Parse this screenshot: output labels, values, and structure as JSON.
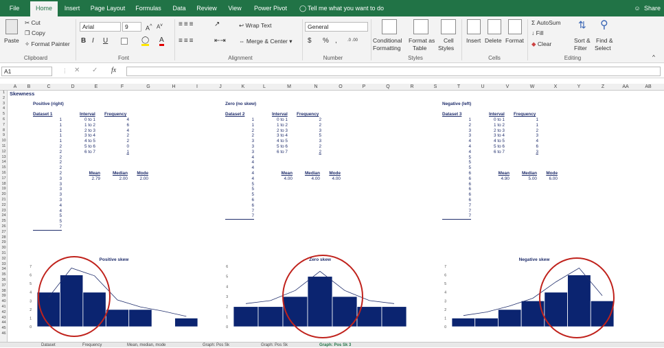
{
  "menu": {
    "tabs": [
      "File",
      "Home",
      "Insert",
      "Page Layout",
      "Formulas",
      "Data",
      "Review",
      "View",
      "Power Pivot"
    ],
    "active": "Home",
    "tell_me": "Tell me what you want to do",
    "share": "Share"
  },
  "ribbon": {
    "clipboard": {
      "paste": "Paste",
      "cut": "Cut",
      "copy": "Copy",
      "format_painter": "Format Painter",
      "label": "Clipboard"
    },
    "font": {
      "name": "Arial",
      "size": "9",
      "label": "Font"
    },
    "alignment": {
      "wrap": "Wrap Text",
      "merge": "Merge & Center",
      "label": "Alignment"
    },
    "number": {
      "format": "General",
      "label": "Number",
      "currency": "$",
      "percent": "%",
      "comma": ","
    },
    "styles": {
      "conditional": "Conditional",
      "formatting": "Formatting",
      "format_as": "Format as",
      "table": "Table",
      "cell": "Cell",
      "cell_styles": "Styles",
      "label": "Styles"
    },
    "cells": {
      "insert": "Insert",
      "delete": "Delete",
      "format": "Format",
      "label": "Cells"
    },
    "editing": {
      "autosum": "AutoSum",
      "fill": "Fill",
      "clear": "Clear",
      "sort": "Sort &",
      "filter": "Filter",
      "find": "Find &",
      "select": "Select",
      "label": "Editing"
    }
  },
  "formula_bar": {
    "name_box": "A1",
    "fx": "fx",
    "value": ""
  },
  "columns": [
    "A",
    "B",
    "C",
    "D",
    "E",
    "F",
    "G",
    "H",
    "I",
    "J",
    "K",
    "L",
    "M",
    "N",
    "O",
    "P",
    "Q",
    "R",
    "S",
    "T",
    "U",
    "V",
    "W",
    "X",
    "Y",
    "Z",
    "AA",
    "AB"
  ],
  "rows": [
    "1",
    "2",
    "3",
    "4",
    "5",
    "6",
    "7",
    "8",
    "9",
    "10",
    "11",
    "12",
    "13",
    "14",
    "15",
    "16",
    "17",
    "18",
    "19",
    "20",
    "21",
    "22",
    "23",
    "24",
    "25",
    "26",
    "27",
    "28",
    "29",
    "30",
    "31",
    "32",
    "33",
    "34",
    "35",
    "36",
    "37",
    "38",
    "39",
    "40",
    "41",
    "42",
    "43",
    "44",
    "45",
    "46"
  ],
  "sheet": {
    "title": "Skewness",
    "sections": [
      {
        "heading": "Positive (right)",
        "dataset_label": "Dataset 1",
        "dataset": [
          "1",
          "1",
          "1",
          "1",
          "1",
          "2",
          "2",
          "2",
          "2",
          "2",
          "2",
          "3",
          "3",
          "3",
          "3",
          "3",
          "4",
          "4",
          "5",
          "5",
          "7"
        ],
        "interval_header": "Interval",
        "frequency_header": "Frequency",
        "intervals": [
          "0 to 1",
          "1 to 2",
          "2 to 3",
          "3 to 4",
          "4 to 5",
          "5 to 6",
          "6 to 7"
        ],
        "frequencies": [
          "4",
          "6",
          "4",
          "2",
          "2",
          "0",
          "1"
        ],
        "mean_label": "Mean",
        "median_label": "Median",
        "mode_label": "Mode",
        "mean": "2.79",
        "median": "2.00",
        "mode": "2.00",
        "chart_title": "Positive skew"
      },
      {
        "heading": "Zero (no skew)",
        "dataset_label": "Dataset 2",
        "dataset": [
          "1",
          "1",
          "2",
          "2",
          "3",
          "3",
          "3",
          "4",
          "4",
          "4",
          "4",
          "4",
          "5",
          "5",
          "5",
          "6",
          "6",
          "7",
          "7"
        ],
        "interval_header": "Interval",
        "frequency_header": "Frequency",
        "intervals": [
          "0 to 1",
          "1 to 2",
          "2 to 3",
          "3 to 4",
          "4 to 5",
          "5 to 6",
          "6 to 7"
        ],
        "frequencies": [
          "2",
          "2",
          "3",
          "5",
          "3",
          "2",
          "2"
        ],
        "mean_label": "Mean",
        "median_label": "Median",
        "mode_label": "Mode",
        "mean": "4.00",
        "median": "4.00",
        "mode": "4.00",
        "chart_title": "Zero skew"
      },
      {
        "heading": "Negative (left)",
        "dataset_label": "Dataset 3",
        "dataset": [
          "1",
          "2",
          "3",
          "3",
          "4",
          "4",
          "4",
          "5",
          "5",
          "5",
          "6",
          "6",
          "6",
          "6",
          "6",
          "6",
          "7",
          "7",
          "7"
        ],
        "interval_header": "Interval",
        "frequency_header": "Frequency",
        "intervals": [
          "0 to 1",
          "1 to 2",
          "2 to 3",
          "3 to 4",
          "4 to 5",
          "5 to 6",
          "6 to 7"
        ],
        "frequencies": [
          "1",
          "1",
          "2",
          "3",
          "4",
          "6",
          "3"
        ],
        "mean_label": "Mean",
        "median_label": "Median",
        "mode_label": "Mode",
        "mean": "4.90",
        "median": "5.00",
        "mode": "6.00",
        "chart_title": "Negative skew"
      }
    ]
  },
  "chart_data": [
    {
      "type": "bar",
      "title": "Positive skew",
      "categories": [
        "0 to 1",
        "1 to 2",
        "2 to 3",
        "3 to 4",
        "4 to 5",
        "5 to 6",
        "6 to 7"
      ],
      "values": [
        4,
        6,
        4,
        2,
        2,
        0,
        1
      ],
      "ylim": [
        0,
        7
      ],
      "yticks": [
        "0",
        "1",
        "2",
        "3",
        "4",
        "5",
        "6",
        "7"
      ],
      "curve": [
        3.4,
        6.8,
        5.9,
        3.1,
        2.3,
        1.8,
        1.2
      ],
      "bar_color": "#0b2470"
    },
    {
      "type": "bar",
      "title": "Zero skew",
      "categories": [
        "0 to 1",
        "1 to 2",
        "2 to 3",
        "3 to 4",
        "4 to 5",
        "5 to 6",
        "6 to 7"
      ],
      "values": [
        2,
        2,
        3,
        5,
        3,
        2,
        2
      ],
      "ylim": [
        0,
        6
      ],
      "yticks": [
        "0",
        "1",
        "2",
        "3",
        "4",
        "5",
        "6"
      ],
      "curve": [
        2.3,
        2.6,
        3.6,
        5.5,
        3.6,
        2.6,
        2.3
      ],
      "bar_color": "#0b2470"
    },
    {
      "type": "bar",
      "title": "Negative skew",
      "categories": [
        "0 to 1",
        "1 to 2",
        "2 to 3",
        "3 to 4",
        "4 to 5",
        "5 to 6",
        "6 to 7"
      ],
      "values": [
        1,
        1,
        2,
        3,
        4,
        6,
        3
      ],
      "ylim": [
        0,
        7
      ],
      "yticks": [
        "0",
        "1",
        "2",
        "3",
        "4",
        "5",
        "6",
        "7"
      ],
      "curve": [
        1.3,
        1.7,
        2.4,
        3.3,
        5.2,
        6.8,
        3.6
      ],
      "bar_color": "#0b2470"
    }
  ],
  "sheet_tabs": [
    "Dataset",
    "Frequency",
    "Mean, median, mode",
    "Graph: Pos Sk",
    "Graph: Pos Sk",
    "Graph: Pos Sk 3"
  ],
  "colors": {
    "excel_green": "#217346",
    "navy": "#0b2470",
    "annotation_red": "#c0221c"
  }
}
